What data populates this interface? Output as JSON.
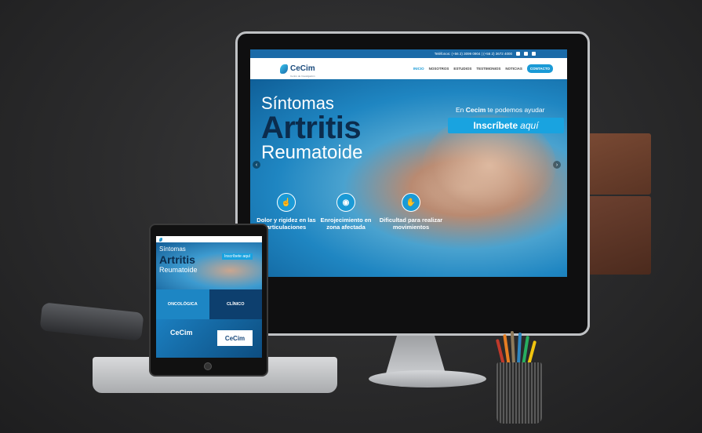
{
  "monitor_site": {
    "topbar": {
      "phone_text": "Teléfonos: (+56 2) 3099 0904 | (+56 2) 3672 4000"
    },
    "logo": {
      "name": "CeCim",
      "tagline": "Centro de Investigación"
    },
    "nav": {
      "items": [
        "INICIO",
        "NOSOTROS",
        "ESTUDIOS",
        "TESTIMONIOS",
        "NOTICIAS"
      ],
      "active": "INICIO",
      "cta": "CONTACTO"
    },
    "hero": {
      "line1": "Síntomas",
      "line2": "Artritis",
      "line3": "Reumatoide",
      "help_prefix": "En",
      "help_brand": "Cecim",
      "help_suffix": "te podemos ayudar",
      "cta_main": "Inscríbete",
      "cta_accent": "aquí",
      "prev_arrow": "‹",
      "next_arrow": "›"
    },
    "features": [
      {
        "icon": "finger-icon",
        "glyph": "☝",
        "text": "Dolor y rigidez en las articulaciones"
      },
      {
        "icon": "inflammation-icon",
        "glyph": "◉",
        "text": "Enrojecimiento en zona afectada"
      },
      {
        "icon": "hand-wave-icon",
        "glyph": "✋",
        "text": "Dificultad para realizar movimientos"
      }
    ]
  },
  "tablet_site": {
    "hero": {
      "line1": "Síntomas",
      "line2": "Artritis",
      "line3": "Reumatoide",
      "cta": "Inscríbete aquí"
    },
    "cards": [
      "ONCOLÓGICA",
      "CLÍNICO"
    ],
    "footer_logo": "CeCim",
    "footer_card": "CeCim"
  },
  "colors": {
    "brand_blue": "#1a9ad6",
    "dark_navy": "#0b2c4d"
  }
}
